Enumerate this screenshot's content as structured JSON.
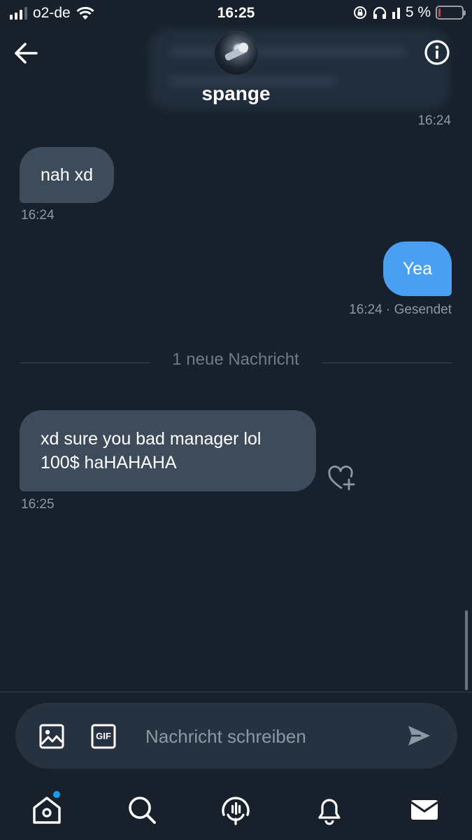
{
  "status_bar": {
    "carrier": "o2-de",
    "time": "16:25",
    "battery_text": "5 %",
    "battery_level": 0.05,
    "battery_color": "#e0393e",
    "icons": [
      "signal-icon",
      "wifi-icon",
      "rotation-lock-icon",
      "headphones-icon",
      "battery-icon"
    ]
  },
  "header": {
    "contact_name": "spange",
    "back_icon": "arrow-left-icon",
    "info_icon": "info-icon"
  },
  "conversation": {
    "top_timestamp": "16:24",
    "messages": [
      {
        "direction": "incoming",
        "text": "nah xd",
        "time": "16:24"
      },
      {
        "direction": "outgoing",
        "text": "Yea",
        "time": "16:24",
        "status": "· Gesendet"
      },
      {
        "direction": "incoming",
        "text_line1": "xd sure you bad manager lol",
        "text_line2": "100$ haHAHAHA",
        "time": "16:25"
      }
    ],
    "new_messages_divider": "1 neue Nachricht",
    "react_icon": "heart-plus-icon"
  },
  "composer": {
    "placeholder": "Nachricht schreiben",
    "value": "",
    "gif_label": "GIF",
    "icons": [
      "image-icon",
      "gif-icon",
      "send-icon"
    ]
  },
  "tabbar": {
    "items": [
      "home-icon",
      "search-icon",
      "spaces-icon",
      "notifications-icon",
      "messages-icon"
    ],
    "home_has_badge": true
  },
  "colors": {
    "background": "#17202b",
    "incoming_bubble": "#3d4b5a",
    "outgoing_bubble": "#4a9ff0",
    "secondary_text": "#8b98a5",
    "accent": "#1d9bf0"
  }
}
